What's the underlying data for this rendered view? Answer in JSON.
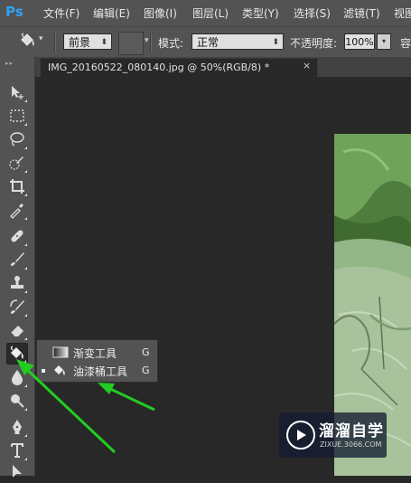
{
  "app": {
    "logo": "Ps"
  },
  "menu": [
    "文件(F)",
    "编辑(E)",
    "图像(I)",
    "图层(L)",
    "类型(Y)",
    "选择(S)",
    "滤镜(T)",
    "视图"
  ],
  "options_bar": {
    "tool_icon": "paint-bucket-icon",
    "fill_source": "前景",
    "mode_label": "模式:",
    "mode_value": "正常",
    "opacity_label": "不透明度:",
    "opacity_value": "100%",
    "tolerance_label": "容"
  },
  "document_tab": {
    "title": "IMG_20160522_080140.jpg @ 50%(RGB/8) *",
    "close": "×"
  },
  "toolbar": {
    "tools": [
      "move-icon",
      "marquee-icon",
      "lasso-icon",
      "quick-select-icon",
      "crop-icon",
      "eyedropper-icon",
      "healing-brush-icon",
      "brush-icon",
      "clone-stamp-icon",
      "history-brush-icon",
      "eraser-icon",
      "paint-bucket-icon",
      "blur-icon",
      "dodge-icon",
      "pen-icon",
      "type-icon",
      "path-select-icon"
    ],
    "active": "paint-bucket-icon"
  },
  "flyout": {
    "items": [
      {
        "label": "渐变工具",
        "shortcut": "G",
        "icon": "gradient-icon",
        "selected": false
      },
      {
        "label": "油漆桶工具",
        "shortcut": "G",
        "icon": "paint-bucket-icon",
        "selected": true
      }
    ]
  },
  "annotation": {
    "color": "#22cc22"
  },
  "watermark": {
    "title": "溜溜自学",
    "url": "ZIXUE.3066.COM"
  },
  "colors": {
    "menubar": "#535353",
    "canvas": "#282828",
    "ps_blue": "#2fa3f5"
  }
}
